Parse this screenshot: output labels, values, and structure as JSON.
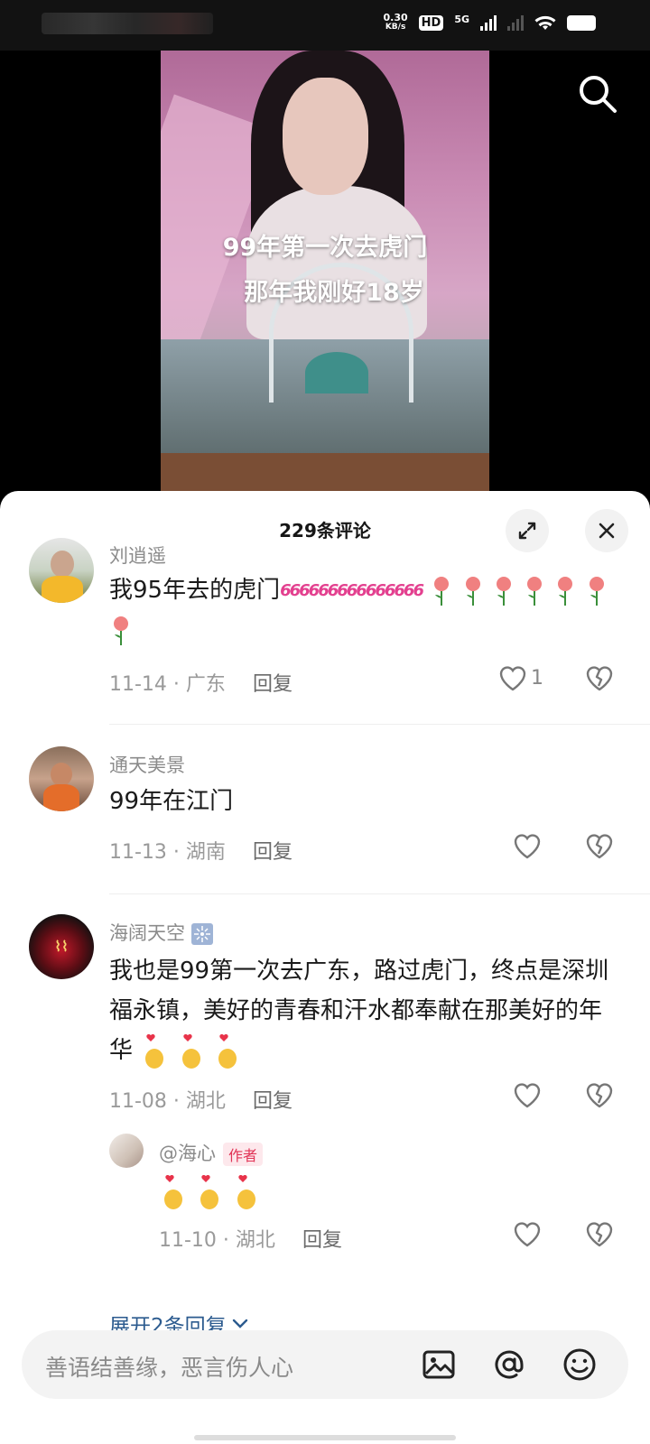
{
  "status_bar": {
    "net_speed": "0.30",
    "net_unit": "KB/s",
    "hd": "HD",
    "network": "5G"
  },
  "video": {
    "overlay_line1": "99年第一次去虎门",
    "overlay_line2": "那年我刚好18岁"
  },
  "sheet": {
    "title": "229条评论"
  },
  "comments": [
    {
      "user": "刘逍遥",
      "text": "我95年去的虎门",
      "emoji_text": "666",
      "date": "11-14",
      "location": "广东",
      "reply_label": "回复",
      "likes": "1"
    },
    {
      "user": "通天美景",
      "text": "99年在江门",
      "date": "11-13",
      "location": "湖南",
      "reply_label": "回复"
    },
    {
      "user": "海阔天空",
      "text": "我也是99第一次去广东，路过虎门，终点是深圳福永镇，美好的青春和汗水都奉献在那美好的年华",
      "date": "11-08",
      "location": "湖北",
      "reply_label": "回复"
    }
  ],
  "reply": {
    "user": "@海心",
    "tag": "作者",
    "date": "11-10",
    "location": "湖北",
    "reply_label": "回复"
  },
  "expand_label": "展开2条回复",
  "bottom_bar": {
    "placeholder": "善语结善缘，恶言伤人心"
  }
}
